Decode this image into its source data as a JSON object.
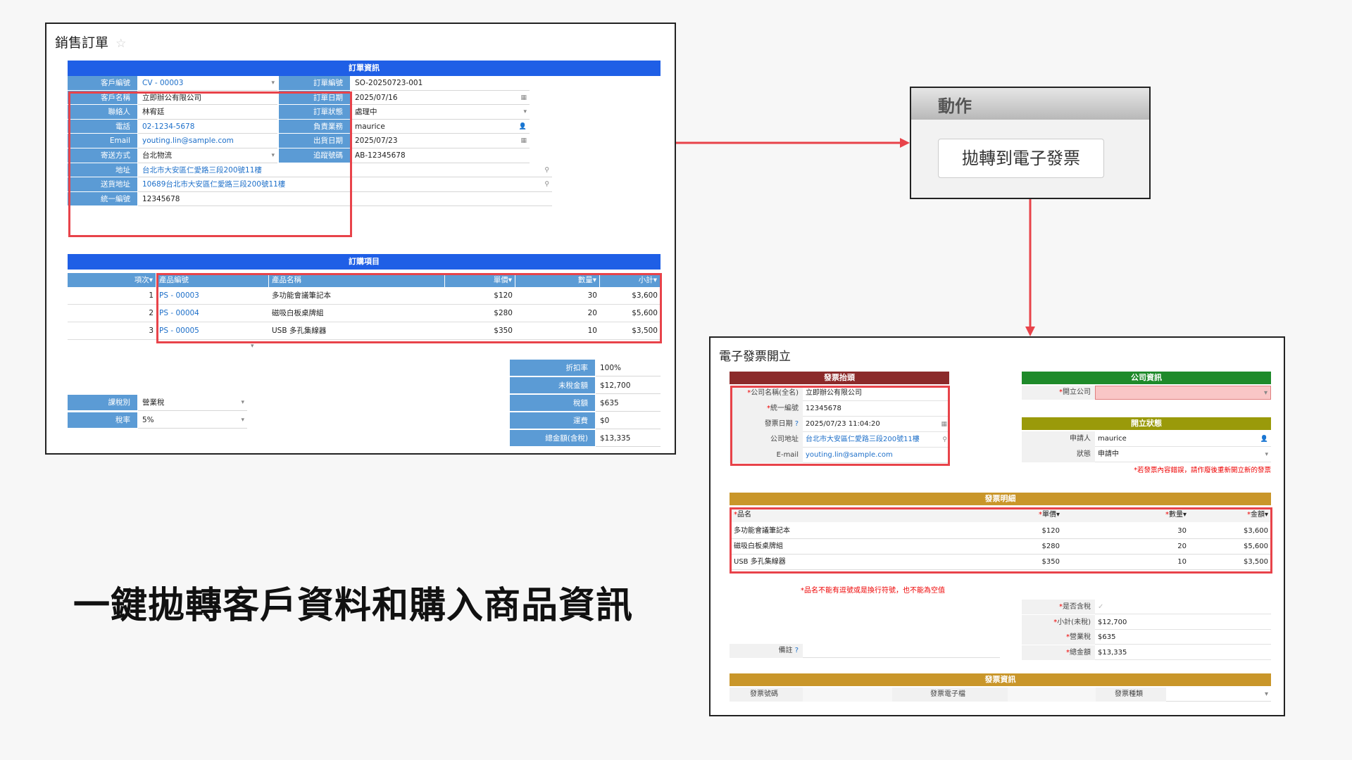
{
  "order": {
    "title": "銷售訂單",
    "star": "☆",
    "section_info": "訂單資訊",
    "left_fields": [
      {
        "label": "客戶編號",
        "value": "CV - 00003",
        "link": true,
        "ind": "▾"
      },
      {
        "label": "客戶名稱",
        "value": "立即辦公有限公司"
      },
      {
        "label": "聯絡人",
        "value": "林宥廷"
      },
      {
        "label": "電話",
        "value": "02-1234-5678",
        "link": true
      },
      {
        "label": "Email",
        "value": "youting.lin@sample.com",
        "link": true
      },
      {
        "label": "寄送方式",
        "value": "台北物流",
        "ind": "▾"
      },
      {
        "label": "地址",
        "value": "台北市大安區仁愛路三段200號11樓",
        "link": true,
        "ind": "⚲"
      },
      {
        "label": "送貨地址",
        "value": "10689台北市大安區仁愛路三段200號11樓",
        "link": true,
        "ind": "⚲"
      },
      {
        "label": "統一編號",
        "value": "12345678"
      }
    ],
    "right_fields": [
      {
        "label": "訂單編號",
        "value": "SO-20250723-001"
      },
      {
        "label": "訂單日期",
        "value": "2025/07/16",
        "ind": "▦"
      },
      {
        "label": "訂單狀態",
        "value": "處理中",
        "ind": "▾"
      },
      {
        "label": "負責業務",
        "value": "maurice",
        "ind": "👤"
      },
      {
        "label": "出貨日期",
        "value": "2025/07/23",
        "ind": "▦"
      },
      {
        "label": "追蹤號碼",
        "value": "AB-12345678"
      }
    ],
    "section_items": "訂購項目",
    "item_headers": [
      "項次▾",
      "產品編號",
      "產品名稱",
      "單價▾",
      "數量▾",
      "小計▾"
    ],
    "items": [
      {
        "no": "1",
        "code": "PS - 00003",
        "name": "多功能會議筆記本",
        "price": "$120",
        "qty": "30",
        "sub": "$3,600"
      },
      {
        "no": "2",
        "code": "PS - 00004",
        "name": "磁吸白板桌牌組",
        "price": "$280",
        "qty": "20",
        "sub": "$5,600"
      },
      {
        "no": "3",
        "code": "PS - 00005",
        "name": "USB 多孔集線器",
        "price": "$350",
        "qty": "10",
        "sub": "$3,500"
      }
    ],
    "tax_fields": [
      {
        "label": "課稅別",
        "value": "營業稅"
      },
      {
        "label": "稅率",
        "value": "5%"
      }
    ],
    "totals": [
      {
        "label": "折扣率",
        "value": "100%"
      },
      {
        "label": "未稅金額",
        "value": "$12,700"
      },
      {
        "label": "稅額",
        "value": "$635"
      },
      {
        "label": "運費",
        "value": "$0"
      },
      {
        "label": "總金額(含稅)",
        "value": "$13,335"
      }
    ]
  },
  "action": {
    "title": "動作",
    "button": "拋轉到電子發票"
  },
  "headline": "一鍵拋轉客戶資料和購入商品資訊",
  "invoice": {
    "title": "電子發票開立",
    "sec_header": "發票抬頭",
    "header_fields": [
      {
        "label": "公司名稱(全名)",
        "req": "*",
        "value": "立即辦公有限公司"
      },
      {
        "label": "統一編號",
        "req": "*",
        "value": "12345678"
      },
      {
        "label": "發票日期",
        "req": "",
        "value": "2025/07/23 11:04:20",
        "help": "?",
        "ind": "▦"
      },
      {
        "label": "公司地址",
        "req": "",
        "value": "台北市大安區仁愛路三段200號11樓",
        "link": true,
        "ind": "⚲"
      },
      {
        "label": "E-mail",
        "req": "",
        "value": "youting.lin@sample.com",
        "link": true
      }
    ],
    "sec_company": "公司資訊",
    "company_field": {
      "label": "開立公司",
      "req": "*",
      "value": ""
    },
    "sec_status": "開立狀態",
    "status_fields": [
      {
        "label": "申請人",
        "value": "maurice",
        "ind": "👤"
      },
      {
        "label": "狀態",
        "value": "申請中",
        "ind": "▾"
      }
    ],
    "status_note": "*若發票內容錯誤，請作廢後重新開立新的發票",
    "sec_detail": "發票明細",
    "detail_headers": [
      "品名",
      "單價▾",
      "數量▾",
      "金額▾"
    ],
    "details": [
      {
        "name": "多功能會議筆記本",
        "price": "$120",
        "qty": "30",
        "amt": "$3,600"
      },
      {
        "name": "磁吸白板桌牌組",
        "price": "$280",
        "qty": "20",
        "amt": "$5,600"
      },
      {
        "name": "USB 多孔集線器",
        "price": "$350",
        "qty": "10",
        "amt": "$3,500"
      }
    ],
    "detail_note": "*品名不能有逗號或是換行符號，也不能為空值",
    "sum_fields": [
      {
        "label": "是否含稅",
        "value": "✓"
      },
      {
        "label": "小計(未稅)",
        "value": "$12,700"
      },
      {
        "label": "營業稅",
        "value": "$635"
      },
      {
        "label": "總金額",
        "value": "$13,335"
      }
    ],
    "remark_label": "備註",
    "remark_help": "?",
    "sec_info": "發票資訊",
    "info_labels": [
      "發票號碼",
      "發票電子檔",
      "發票種類"
    ]
  },
  "colors": {
    "blue": "#1f5fe6",
    "lightblue": "#5b9bd5",
    "red": "#e8434a",
    "maroon": "#8b2a2a",
    "green": "#1e8a2a",
    "olive": "#9a9a0a",
    "gold": "#c9962a"
  }
}
